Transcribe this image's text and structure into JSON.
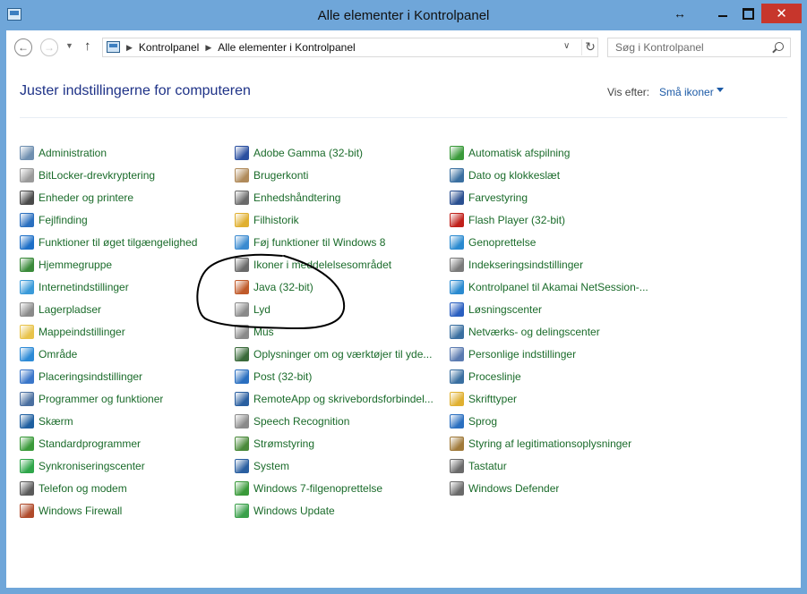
{
  "window": {
    "title": "Alle elementer i Kontrolpanel",
    "buttons": {
      "resize": "↔",
      "minimize": "—",
      "maximize": "☐",
      "close": "✕"
    }
  },
  "nav": {
    "back": "←",
    "forward": "→",
    "dropdown": "▼",
    "up": "↑",
    "breadcrumb": [
      "Kontrolpanel",
      "Alle elementer i Kontrolpanel"
    ],
    "breadcrumb_sep": "▶",
    "address_dropdown": "∨",
    "refresh": "↻",
    "search_placeholder": "Søg i Kontrolpanel"
  },
  "header": {
    "title": "Juster indstillingerne for computeren",
    "view_by_label": "Vis efter:",
    "view_by_value": "Små ikoner"
  },
  "columns": [
    {
      "items": [
        {
          "label": "Administration",
          "icon": "administration-icon",
          "color": "#6f8fb0"
        },
        {
          "label": "BitLocker-drevkryptering",
          "icon": "bitlocker-icon",
          "color": "#9a9a9a"
        },
        {
          "label": "Enheder og printere",
          "icon": "devices-printers-icon",
          "color": "#4a4a4a"
        },
        {
          "label": "Fejlfinding",
          "icon": "troubleshooting-icon",
          "color": "#2a6fbf"
        },
        {
          "label": "Funktioner til øget tilgængelighed",
          "icon": "accessibility-icon",
          "color": "#1d6fc7"
        },
        {
          "label": "Hjemmegruppe",
          "icon": "homegroup-icon",
          "color": "#3a8a3a"
        },
        {
          "label": "Internetindstillinger",
          "icon": "internet-options-icon",
          "color": "#3a9ad9"
        },
        {
          "label": "Lagerpladser",
          "icon": "storage-spaces-icon",
          "color": "#8a8a8a"
        },
        {
          "label": "Mappeindstillinger",
          "icon": "folder-options-icon",
          "color": "#e8c34a"
        },
        {
          "label": "Område",
          "icon": "region-icon",
          "color": "#2c8ad6"
        },
        {
          "label": "Placeringsindstillinger",
          "icon": "location-settings-icon",
          "color": "#3a76c9"
        },
        {
          "label": "Programmer og funktioner",
          "icon": "programs-features-icon",
          "color": "#4a6fa0"
        },
        {
          "label": "Skærm",
          "icon": "display-icon",
          "color": "#1e5fa0"
        },
        {
          "label": "Standardprogrammer",
          "icon": "default-programs-icon",
          "color": "#3a9a3a"
        },
        {
          "label": "Synkroniseringscenter",
          "icon": "sync-center-icon",
          "color": "#2fa64a"
        },
        {
          "label": "Telefon og modem",
          "icon": "phone-modem-icon",
          "color": "#5a5a5a"
        },
        {
          "label": "Windows Firewall",
          "icon": "firewall-icon",
          "color": "#b04a2a"
        }
      ]
    },
    {
      "items": [
        {
          "label": "Adobe Gamma (32-bit)",
          "icon": "adobe-gamma-icon",
          "color": "#2a4fa0"
        },
        {
          "label": "Brugerkonti",
          "icon": "user-accounts-icon",
          "color": "#b08a5a"
        },
        {
          "label": "Enhedshåndtering",
          "icon": "device-manager-icon",
          "color": "#6a6a6a"
        },
        {
          "label": "Filhistorik",
          "icon": "file-history-icon",
          "color": "#e0b030"
        },
        {
          "label": "Føj funktioner til Windows 8",
          "icon": "add-features-icon",
          "color": "#3a8ad0"
        },
        {
          "label": "Ikoner i meddelelsesområdet",
          "icon": "notification-icons-icon",
          "color": "#6a6a6a"
        },
        {
          "label": "Java (32-bit)",
          "icon": "java-icon",
          "color": "#c05a2a"
        },
        {
          "label": "Lyd",
          "icon": "sound-icon",
          "color": "#8a8a8a"
        },
        {
          "label": "Mus",
          "icon": "mouse-icon",
          "color": "#8a8a8a"
        },
        {
          "label": "Oplysninger om og værktøjer til yde...",
          "icon": "performance-icon",
          "color": "#3a6a3a"
        },
        {
          "label": "Post (32-bit)",
          "icon": "mail-icon",
          "color": "#2a6fc0"
        },
        {
          "label": "RemoteApp og skrivebordsforbindel...",
          "icon": "remoteapp-icon",
          "color": "#2a5fa0"
        },
        {
          "label": "Speech Recognition",
          "icon": "microphone-icon",
          "color": "#8a8a8a"
        },
        {
          "label": "Strømstyring",
          "icon": "power-options-icon",
          "color": "#4a8a3a"
        },
        {
          "label": "System",
          "icon": "system-icon",
          "color": "#2a5fa0"
        },
        {
          "label": "Windows 7-filgenoprettelse",
          "icon": "windows7-recovery-icon",
          "color": "#3a9a3a"
        },
        {
          "label": "Windows Update",
          "icon": "windows-update-icon",
          "color": "#3aa04a"
        }
      ]
    },
    {
      "items": [
        {
          "label": "Automatisk afspilning",
          "icon": "autoplay-icon",
          "color": "#3a9a3a"
        },
        {
          "label": "Dato og klokkeslæt",
          "icon": "date-time-icon",
          "color": "#3a6fa0"
        },
        {
          "label": "Farvestyring",
          "icon": "color-management-icon",
          "color": "#2a4f90"
        },
        {
          "label": "Flash Player (32-bit)",
          "icon": "flash-player-icon",
          "color": "#c0201a"
        },
        {
          "label": "Genoprettelse",
          "icon": "recovery-icon",
          "color": "#2a8ad0"
        },
        {
          "label": "Indekseringsindstillinger",
          "icon": "indexing-icon",
          "color": "#7a7a7a"
        },
        {
          "label": "Kontrolpanel til Akamai NetSession-...",
          "icon": "akamai-icon",
          "color": "#2a8ad0"
        },
        {
          "label": "Løsningscenter",
          "icon": "action-center-flag-icon",
          "color": "#2a5fc0"
        },
        {
          "label": "Netværks- og delingscenter",
          "icon": "network-sharing-icon",
          "color": "#3a6fa0"
        },
        {
          "label": "Personlige indstillinger",
          "icon": "personalization-icon",
          "color": "#5a7ab0"
        },
        {
          "label": "Proceslinje",
          "icon": "taskbar-icon",
          "color": "#3a6fa0"
        },
        {
          "label": "Skrifttyper",
          "icon": "fonts-icon",
          "color": "#e0b030"
        },
        {
          "label": "Sprog",
          "icon": "language-icon",
          "color": "#2a6fc0"
        },
        {
          "label": "Styring af legitimationsoplysninger",
          "icon": "credential-manager-icon",
          "color": "#a07a3a"
        },
        {
          "label": "Tastatur",
          "icon": "keyboard-icon",
          "color": "#6a6a6a"
        },
        {
          "label": "Windows Defender",
          "icon": "windows-defender-icon",
          "color": "#6a6a6a"
        }
      ]
    }
  ]
}
